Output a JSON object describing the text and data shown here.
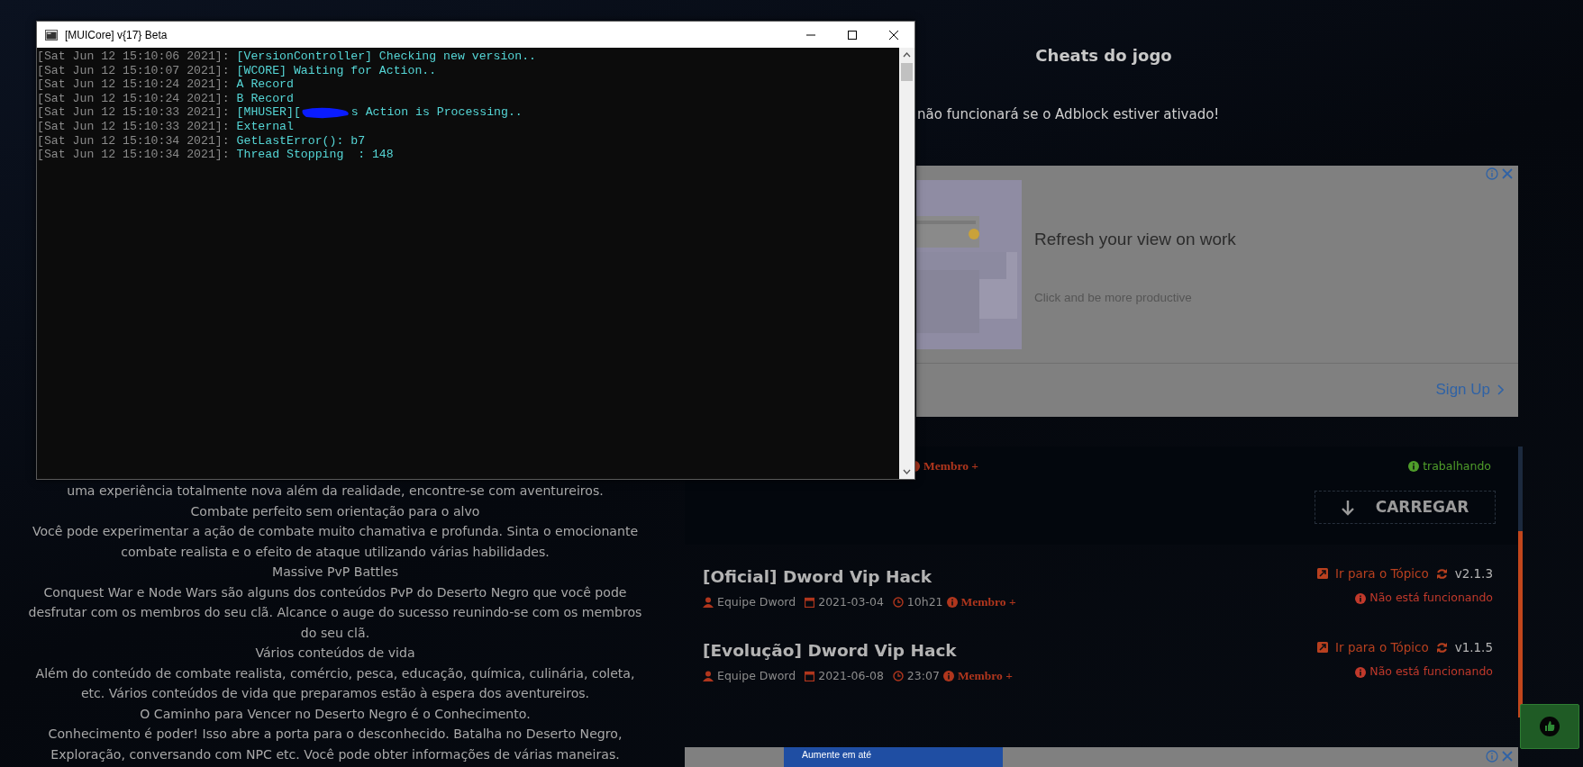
{
  "console_window": {
    "title": "[MUICore] v{17} Beta",
    "log": [
      {
        "time": "[Sat Jun 12 15:10:06 2021]:",
        "message": "[VersionController] Checking new version.."
      },
      {
        "time": "[Sat Jun 12 15:10:07 2021]:",
        "message": "[WCORE] Waiting for Action.."
      },
      {
        "time": "[Sat Jun 12 15:10:24 2021]:",
        "message": "A Record"
      },
      {
        "time": "[Sat Jun 12 15:10:24 2021]:",
        "message": "B Record"
      },
      {
        "time": "[Sat Jun 12 15:10:33 2021]:",
        "message": "[MHUSER][",
        "redacted": true,
        "message_after": "s Action is Processing.."
      },
      {
        "time": "[Sat Jun 12 15:10:33 2021]:",
        "message": "External"
      },
      {
        "time": "[Sat Jun 12 15:10:34 2021]:",
        "message": "GetLastError(): b7"
      },
      {
        "time": "[Sat Jun 12 15:10:34 2021]:",
        "message": "Thread Stopping  : 148"
      }
    ]
  },
  "page": {
    "heading": "Cheats do jogo",
    "adblock_notice": "não funcionará se o Adblock estiver ativado!",
    "description": [
      "uma experiência totalmente nova além da realidade, encontre-se com aventureiros.",
      "Combate perfeito sem orientação para o alvo",
      "Você pode experimentar a ação de combate muito chamativa e profunda. Sinta o emocionante combate realista e o efeito de ataque utilizando várias habilidades.",
      "Massive PvP Battles",
      "Conquest War e Node Wars são alguns dos conteúdos PvP do Deserto Negro que você pode desfrutar com os membros do seu clã. Alcance o auge do sucesso reunindo-se com os membros do seu clã.",
      "Vários conteúdos de vida",
      "Além do conteúdo de combate realista, comércio, pesca, educação, química, culinária, coleta, etc. Vários conteúdos de vida que preparamos estão à espera dos aventureiros.",
      "O Caminho para Vencer no Deserto Negro é o Conhecimento.",
      "Conhecimento é poder! Isso abre a porta para o desconhecido. Batalha no Deserto Negro, Exploração, conversando com NPC etc. Você pode obter informações de várias maneiras."
    ],
    "ad": {
      "title": "Refresh your view on work",
      "subtitle": "Click and be more productive",
      "cta": "Sign Up"
    },
    "cheats": [
      {
        "membership": "Membro +",
        "status": "trabalhando",
        "working": true,
        "button": "CARREGAR"
      },
      {
        "title": "[Oficial] Dword Vip Hack",
        "author": "Equipe Dword",
        "date": "2021-03-04",
        "time": "10h21",
        "membership": "Membro +",
        "link": "Ir para o Tópico",
        "version": "v2.1.3",
        "status": "Não está funcionando",
        "working": false
      },
      {
        "title": "[Evolução] Dword Vip Hack",
        "author": "Equipe Dword",
        "date": "2021-06-08",
        "time": "23:07",
        "membership": "Membro +",
        "link": "Ir para o Tópico",
        "version": "v1.1.5",
        "status": "Não está funcionando",
        "working": false
      }
    ],
    "bottom_ad": {
      "text": "Aumente em até"
    }
  }
}
